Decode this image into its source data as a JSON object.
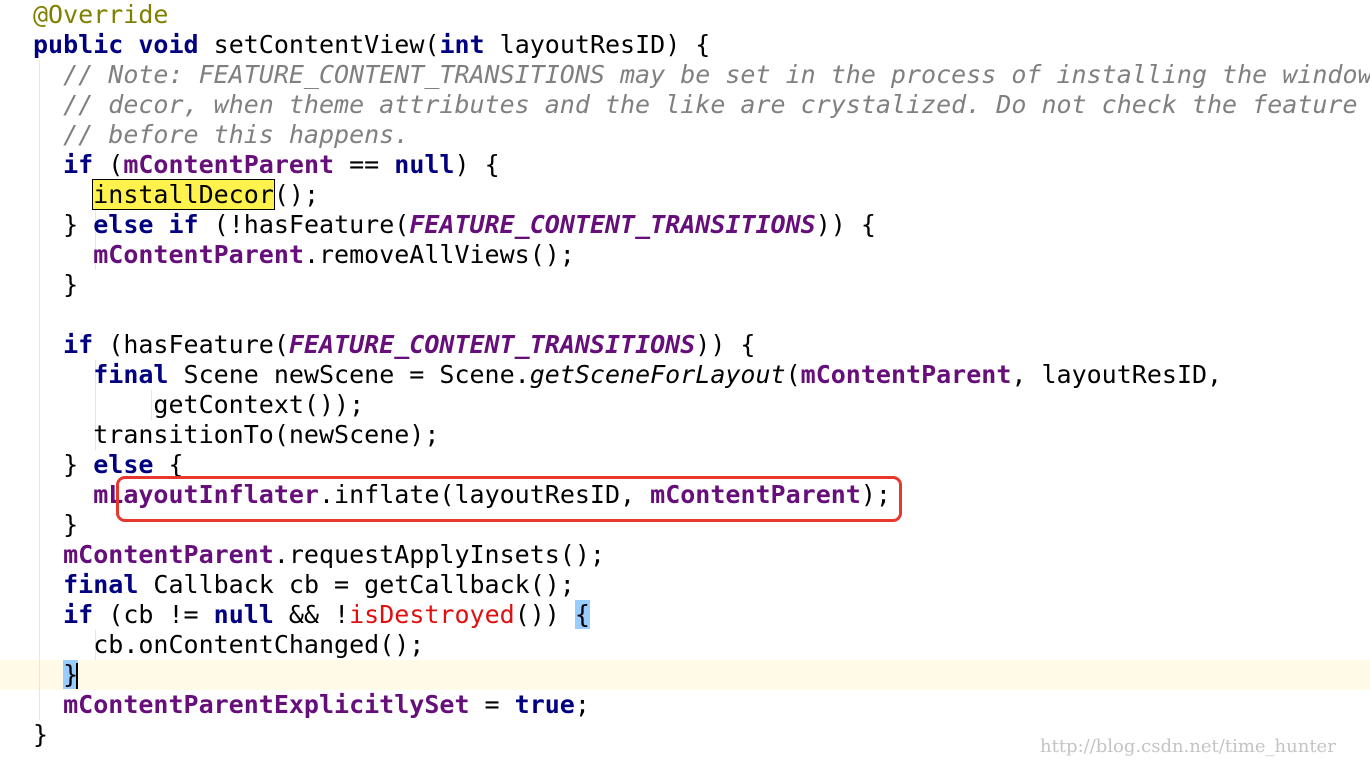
{
  "code": {
    "annotation": "@Override",
    "sig_public": "public",
    "sig_void": "void",
    "sig_name": "setContentView(",
    "sig_int": "int",
    "sig_rest": " layoutResID) {",
    "comment_1": "// Note: FEATURE_CONTENT_TRANSITIONS may be set in the process of installing the window",
    "comment_2": "// decor, when theme attributes and the like are crystalized. Do not check the feature",
    "comment_3": "// before this happens.",
    "kw_if": "if",
    "kw_else": "else",
    "kw_null": "null",
    "kw_final": "final",
    "kw_true": "true",
    "open_paren": " (",
    "field_content_parent": "mContentParent",
    "eq_null": " == ",
    "close_brace_open": ") {",
    "install_decor": "installDecor",
    "install_decor_tail": "();",
    "close_brace": "}",
    "close_brace_space": "} ",
    "not_has_feature": " (!hasFeature(",
    "feature_const": "FEATURE_CONTENT_TRANSITIONS",
    "double_close_open": ")) {",
    "remove_all_views": ".removeAllViews();",
    "has_feature": " (hasFeature(",
    "scene_decl": " Scene newScene = Scene.",
    "get_scene": "getSceneForLayout",
    "paren_open": "(",
    "layout_arg": ", layoutResID,",
    "get_context": "getContext());",
    "transition_to": "transitionTo(newScene);",
    "brace_open": " {",
    "field_layout_inflater": "mLayoutInflater",
    "inflate_call": ".inflate(layoutResID, ",
    "inflate_end": ");",
    "request_insets": ".requestApplyInsets();",
    "callback_decl": " Callback cb = getCallback();",
    "cb_check": " (cb != ",
    "and_not": " && !",
    "is_destroyed": "isDestroyed",
    "cb_check_end": "()) ",
    "brace_only": "{",
    "on_content_changed": "cb.onContentChanged();",
    "field_explicitly_set": "mContentParentExplicitlySet",
    "assign": " = ",
    "semicolon": ";"
  },
  "watermark": "http://blog.csdn.net/time_hunter"
}
